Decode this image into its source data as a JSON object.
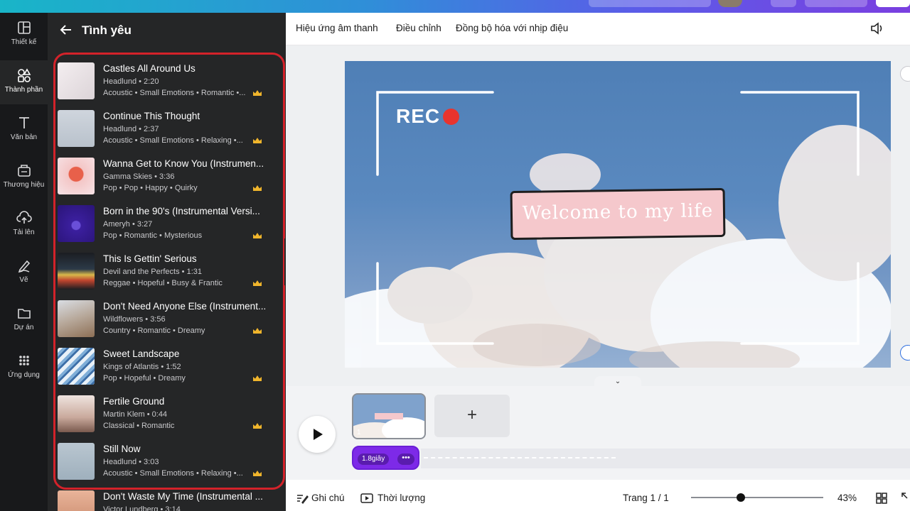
{
  "rail": {
    "items": [
      {
        "label": "Thiết kế",
        "icon": "layout-icon"
      },
      {
        "label": "Thành phần",
        "icon": "elements-icon"
      },
      {
        "label": "Văn bản",
        "icon": "text-icon"
      },
      {
        "label": "Thương hiệu",
        "icon": "brand-icon"
      },
      {
        "label": "Tải lên",
        "icon": "upload-icon"
      },
      {
        "label": "Vẽ",
        "icon": "draw-icon"
      },
      {
        "label": "Dự án",
        "icon": "folder-icon"
      },
      {
        "label": "Ứng dụng",
        "icon": "apps-icon"
      }
    ]
  },
  "panel": {
    "title": "Tình yêu",
    "tracks": [
      {
        "title": "Castles All Around Us",
        "meta": "Headlund • 2:20",
        "tags": "Acoustic • Small Emotions • Romantic •..."
      },
      {
        "title": "Continue This Thought",
        "meta": "Headlund • 2:37",
        "tags": "Acoustic • Small Emotions • Relaxing •..."
      },
      {
        "title": "Wanna Get to Know You (Instrumen...",
        "meta": "Gamma Skies • 3:36",
        "tags": "Pop • Pop • Happy • Quirky"
      },
      {
        "title": "Born in the 90's (Instrumental Versi...",
        "meta": "Ameryh • 3:27",
        "tags": "Pop • Romantic • Mysterious"
      },
      {
        "title": "This Is Gettin' Serious",
        "meta": "Devil and the Perfects • 1:31",
        "tags": "Reggae • Hopeful • Busy & Frantic"
      },
      {
        "title": "Don't Need Anyone Else (Instrument...",
        "meta": "Wildflowers • 3:56",
        "tags": "Country • Romantic • Dreamy"
      },
      {
        "title": "Sweet Landscape",
        "meta": "Kings of Atlantis • 1:52",
        "tags": "Pop • Hopeful • Dreamy"
      },
      {
        "title": "Fertile Ground",
        "meta": "Martin Klem • 0:44",
        "tags": "Classical • Romantic"
      },
      {
        "title": "Still Now",
        "meta": "Headlund • 3:03",
        "tags": "Acoustic • Small Emotions • Relaxing •..."
      },
      {
        "title": "Don't Waste My Time (Instrumental ...",
        "meta": "Victor Lundberg • 3:14",
        "tags": ""
      }
    ]
  },
  "toolbar": {
    "audio_effects": "Hiệu ứng âm thanh",
    "adjust": "Điều chỉnh",
    "sync_beat": "Đồng bộ hóa với nhịp điệu"
  },
  "canvas": {
    "rec_label": "REC",
    "banner_text": "Welcome to my life"
  },
  "timeline": {
    "clip_number": "1",
    "audio_duration": "1.8giây",
    "audio_more": "•••",
    "add_label": "+"
  },
  "footer": {
    "notes": "Ghi chú",
    "duration": "Thời lượng",
    "page": "Trang 1 / 1",
    "zoom": "43%",
    "zoom_level": 0.35
  },
  "colors": {
    "accent_red": "#d3222a",
    "audio_purple": "#7d2ae8",
    "rec_dot": "#e8342e",
    "banner_pink": "#f5c8cc"
  }
}
